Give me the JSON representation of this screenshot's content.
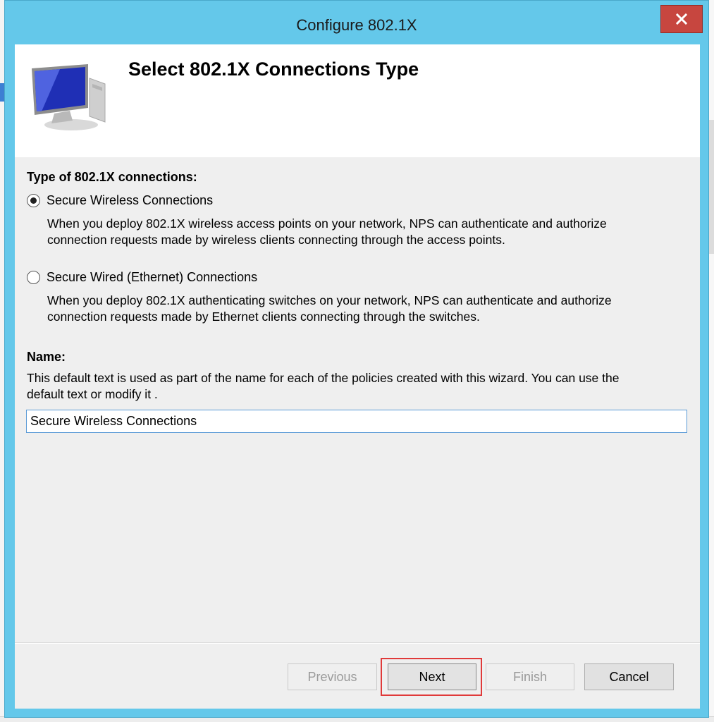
{
  "window": {
    "title": "Configure 802.1X"
  },
  "header": {
    "title": "Select 802.1X Connections Type",
    "icon": "computer-icon"
  },
  "connection_type": {
    "label": "Type of 802.1X connections:",
    "options": [
      {
        "label": "Secure Wireless Connections",
        "selected": true,
        "description_line1": "When you deploy 802.1X wireless access points on your network, NPS can authenticate and authorize",
        "description_line2": "connection requests made by wireless clients connecting through the access points."
      },
      {
        "label": "Secure Wired (Ethernet) Connections",
        "selected": false,
        "description_line1": "When you deploy 802.1X authenticating switches on your network, NPS can authenticate and authorize",
        "description_line2": "connection requests made by Ethernet clients connecting through the switches."
      }
    ]
  },
  "name_section": {
    "label": "Name:",
    "description_line1": "This default text is used as part of the name for each of the policies created with this wizard. You can use the",
    "description_line2": "default text or modify it .",
    "value": "Secure Wireless Connections"
  },
  "buttons": {
    "previous": "Previous",
    "next": "Next",
    "finish": "Finish",
    "cancel": "Cancel"
  },
  "colors": {
    "title_bar": "#64c8ea",
    "close_button": "#c7463f",
    "highlight": "#e03a3a"
  }
}
